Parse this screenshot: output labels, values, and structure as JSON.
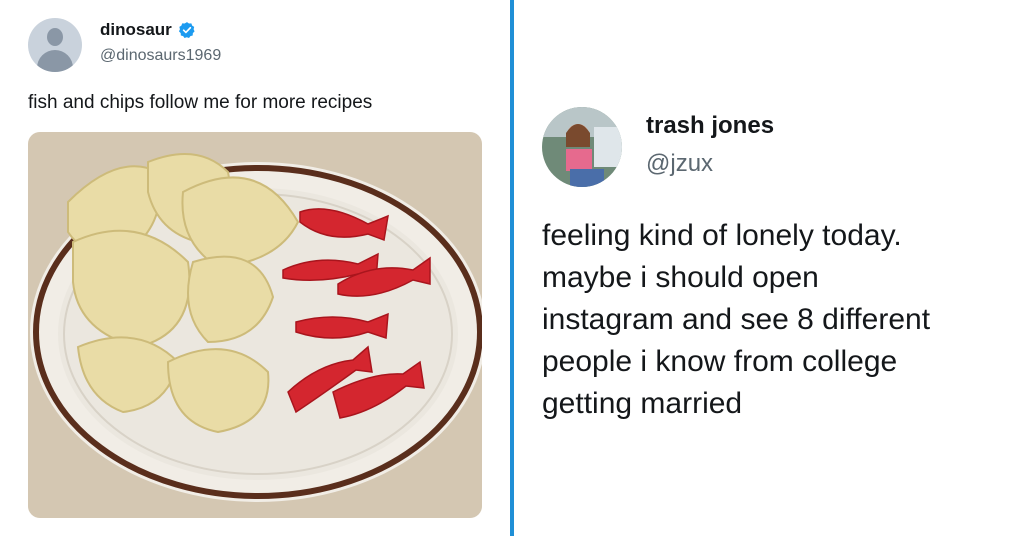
{
  "left_tweet": {
    "display_name": "dinosaur",
    "handle": "@dinosaurs1969",
    "text": "fish and chips follow me for more recipes",
    "verified": true,
    "avatar_icon": "default-avatar-icon",
    "photo": "plate-of-potato-chips-and-red-gummy-fish"
  },
  "right_tweet": {
    "display_name": "trash jones",
    "handle": "@jzux",
    "avatar": "profile-photo-person-pink-top",
    "text_lines": [
      "feeling kind of lonely today.",
      "maybe i should open",
      "instagram and see 8 different",
      "people i know from college",
      "getting married"
    ]
  },
  "colors": {
    "divider": "#1f8fd6",
    "verified_badge": "#1d9bf0",
    "handle_text": "#5b6770"
  }
}
